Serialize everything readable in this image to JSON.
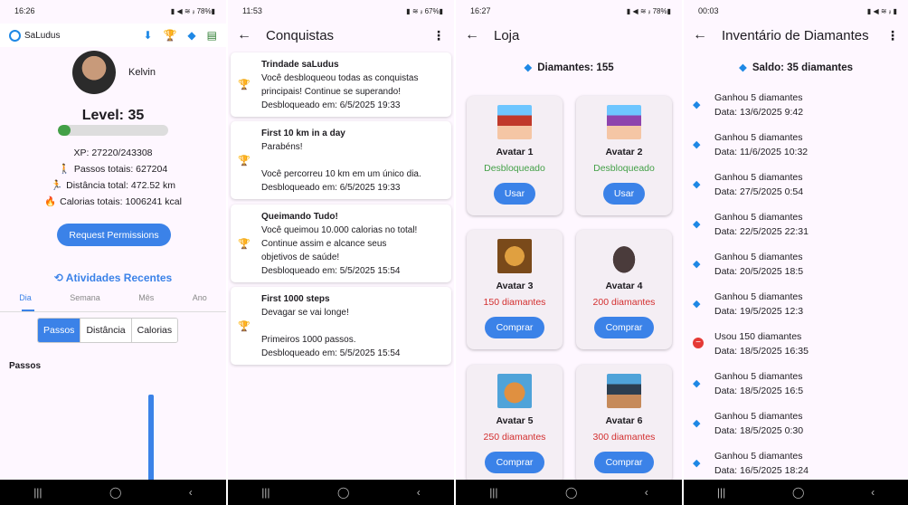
{
  "colors": {
    "primary": "#3b82e8",
    "green": "#43a047",
    "red": "#d32f2f",
    "gold": "#f4b400"
  },
  "nav": {
    "recent": "|||",
    "home": "◯",
    "back": "‹"
  },
  "screen1": {
    "status": {
      "time": "16:26",
      "right": "▮ ◀ ≋ ᵢₗ 78%▮"
    },
    "brand": "SaLudus",
    "user": "Kelvin",
    "level": "Level: 35",
    "level_progress": 0.112,
    "xp": "XP: 27220/243308",
    "steps": "Passos totais: 627204",
    "distance": "Distância total: 472.52 km",
    "calories": "Calorias totais: 1006241 kcal",
    "request_btn": "Request Permissions",
    "recent_title": "Atividades Recentes",
    "tabs": [
      "Dia",
      "Semana",
      "Mês",
      "Ano"
    ],
    "segments": [
      "Passos",
      "Distância",
      "Calorias"
    ],
    "chart_title": "Passos"
  },
  "screen2": {
    "status": {
      "time": "11:53",
      "right": "▮ ≋ ᵢₗ 67%▮"
    },
    "title": "Conquistas",
    "items": [
      {
        "title": "Trindade saLudus",
        "msg": "Você desbloqueou todas as conquistas\nprincipais! Continue se superando!",
        "date": "Desbloqueado em: 6/5/2025 19:33"
      },
      {
        "title": "First 10 km in a day",
        "msg": "Parabéns!\n\nVocê percorreu 10 km em um único dia.",
        "date": "Desbloqueado em: 6/5/2025 19:33"
      },
      {
        "title": "Queimando Tudo!",
        "msg": "Você queimou 10.000 calorias no total!\nContinue assim e alcance seus\nobjetivos de saúde!",
        "date": "Desbloqueado em: 5/5/2025 15:54"
      },
      {
        "title": "First 1000 steps",
        "msg": "Devagar se vai longe!\n\nPrimeiros 1000 passos.",
        "date": "Desbloqueado em: 5/5/2025 15:54"
      }
    ]
  },
  "screen3": {
    "status": {
      "time": "16:27",
      "right": "▮ ◀ ≋ ᵢₗ 78%▮"
    },
    "title": "Loja",
    "balance": "Diamantes: 155",
    "items": [
      {
        "name": "Avatar 1",
        "state": "Desbloqueado",
        "action": "Usar"
      },
      {
        "name": "Avatar 2",
        "state": "Desbloqueado",
        "action": "Usar"
      },
      {
        "name": "Avatar 3",
        "state": "150 diamantes",
        "action": "Comprar"
      },
      {
        "name": "Avatar 4",
        "state": "200 diamantes",
        "action": "Comprar"
      },
      {
        "name": "Avatar 5",
        "state": "250 diamantes",
        "action": "Comprar"
      },
      {
        "name": "Avatar 6",
        "state": "300 diamantes",
        "action": "Comprar"
      }
    ]
  },
  "screen4": {
    "status": {
      "time": "00:03",
      "right": "▮ ◀ ≋ ᵢₗ ▮"
    },
    "title": "Inventário de Diamantes",
    "balance": "Saldo: 35 diamantes",
    "entries": [
      {
        "type": "gain",
        "title": "Ganhou 5 diamantes",
        "date": "Data: 13/6/2025 9:42"
      },
      {
        "type": "gain",
        "title": "Ganhou 5 diamantes",
        "date": "Data: 11/6/2025 10:32"
      },
      {
        "type": "gain",
        "title": "Ganhou 5 diamantes",
        "date": "Data: 27/5/2025 0:54"
      },
      {
        "type": "gain",
        "title": "Ganhou 5 diamantes",
        "date": "Data: 22/5/2025 22:31"
      },
      {
        "type": "gain",
        "title": "Ganhou 5 diamantes",
        "date": "Data: 20/5/2025 18:5"
      },
      {
        "type": "gain",
        "title": "Ganhou 5 diamantes",
        "date": "Data: 19/5/2025 12:3"
      },
      {
        "type": "spend",
        "title": "Usou 150 diamantes",
        "date": "Data: 18/5/2025 16:35"
      },
      {
        "type": "gain",
        "title": "Ganhou 5 diamantes",
        "date": "Data: 18/5/2025 16:5"
      },
      {
        "type": "gain",
        "title": "Ganhou 5 diamantes",
        "date": "Data: 18/5/2025 0:30"
      },
      {
        "type": "gain",
        "title": "Ganhou 5 diamantes",
        "date": "Data: 16/5/2025 18:24"
      }
    ]
  }
}
